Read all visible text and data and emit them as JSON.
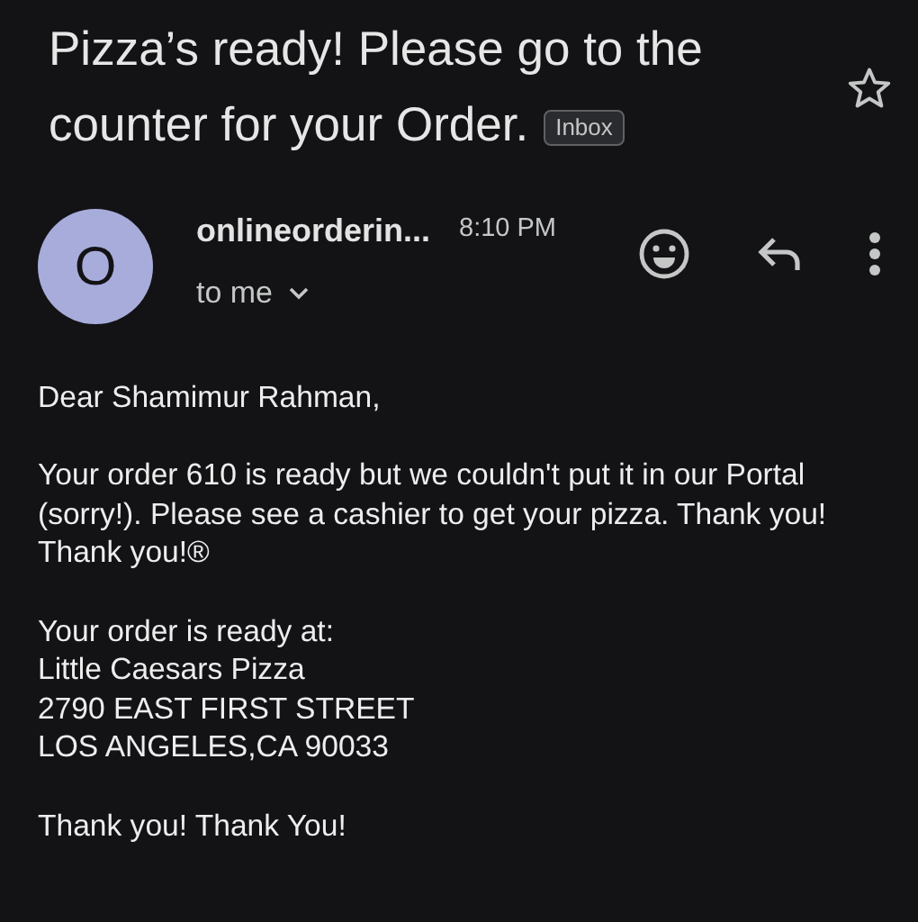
{
  "subject": {
    "lines": [
      "Pizza’s ready! Please go to the",
      "counter for your Order."
    ],
    "label": "Inbox",
    "starred": false
  },
  "sender": {
    "avatar_letter": "O",
    "name": "onlineorderin...",
    "time": "8:10 PM",
    "recipient": "to me"
  },
  "body": [
    {
      "lines": [
        "Dear Shamimur Rahman,"
      ]
    },
    {
      "lines": [
        "Your order 610 is ready but we couldn't put it in our Portal (sorry!). Please see a cashier to get your pizza. Thank you! Thank you!®"
      ]
    },
    {
      "lines": [
        "Your order is ready at:",
        "Little Caesars Pizza",
        "2790 EAST FIRST STREET",
        "LOS ANGELES,CA 90033"
      ]
    },
    {
      "lines": [
        "Thank you! Thank You!"
      ]
    }
  ]
}
